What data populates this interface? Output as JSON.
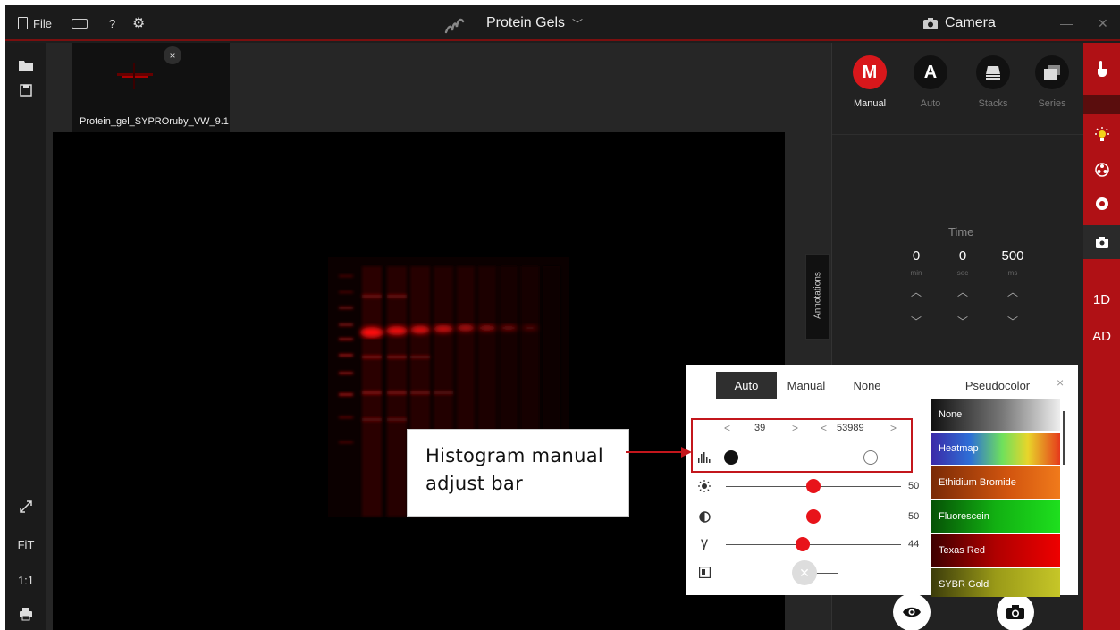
{
  "topbar": {
    "file_label": "File",
    "help_label": "?",
    "title": "Protein Gels",
    "title_chevron": "﹀",
    "camera_label": "Camera",
    "minimize": "—",
    "close": "✕"
  },
  "thumbnail": {
    "label": "Protein_gel_SYPROruby_VW_9.1",
    "close": "×"
  },
  "annotations_tab": "Annotations",
  "left_tools": {
    "fit": "FiT",
    "one_to_one": "1:1"
  },
  "camera_panel": {
    "modes": [
      {
        "letter": "M",
        "label": "Manual"
      },
      {
        "letter": "A",
        "label": "Auto"
      },
      {
        "letter": "",
        "label": "Stacks"
      },
      {
        "letter": "",
        "label": "Series"
      }
    ],
    "time": {
      "title": "Time",
      "min": {
        "value": "0",
        "unit": "min"
      },
      "sec": {
        "value": "0",
        "unit": "sec"
      },
      "ms": {
        "value": "500",
        "unit": "ms"
      },
      "up": "︿",
      "down": "﹀"
    }
  },
  "right_rail": {
    "one_d": "1D",
    "ad": "AD"
  },
  "popup": {
    "tabs": [
      "Auto",
      "Manual",
      "None"
    ],
    "active_tab": "Auto",
    "pseudocolor_title": "Pseudocolor",
    "close": "×",
    "histogram": {
      "low": "39",
      "high": "53989",
      "prev": "<",
      "next": ">",
      "low_fraction": 0.0,
      "high_fraction": 0.82
    },
    "brightness": {
      "value": "50",
      "fraction": 0.5
    },
    "contrast": {
      "value": "50",
      "fraction": 0.5
    },
    "gamma": {
      "label": "γ",
      "value": "44",
      "fraction": 0.44
    },
    "pseudocolors": [
      "None",
      "Heatmap",
      "Ethidium Bromide",
      "Fluorescein",
      "Texas Red",
      "SYBR Gold"
    ]
  },
  "callout": {
    "line1": "Histogram manual",
    "line2": "adjust bar"
  },
  "colors": {
    "accent_red": "#d8171b",
    "dark_bg": "#1e1e1e",
    "panel_bg": "#222222"
  }
}
